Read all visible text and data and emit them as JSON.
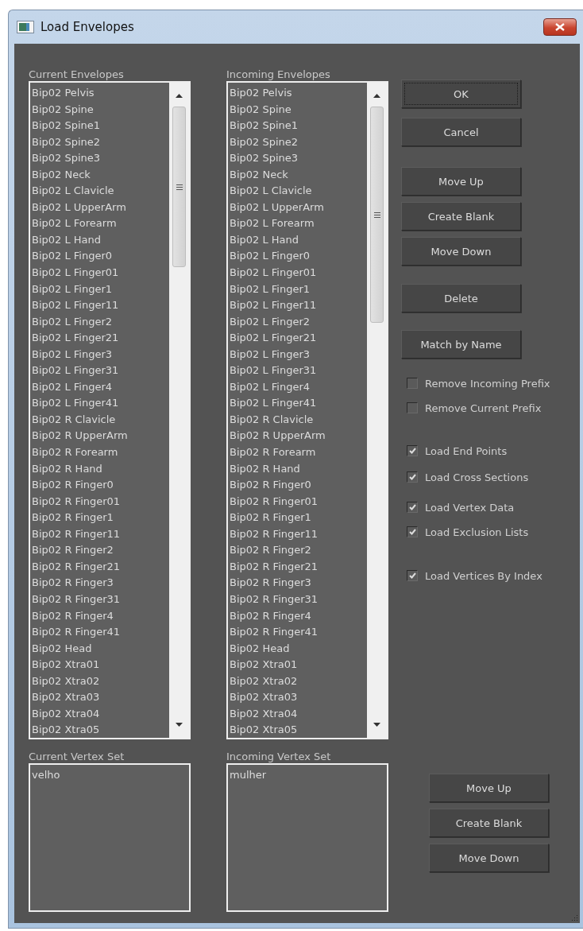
{
  "window": {
    "title": "Load Envelopes"
  },
  "current_envelopes": {
    "label": "Current Envelopes",
    "items": [
      "Bip02 Pelvis",
      "Bip02 Spine",
      "Bip02 Spine1",
      "Bip02 Spine2",
      "Bip02 Spine3",
      "Bip02 Neck",
      "Bip02 L Clavicle",
      "Bip02 L UpperArm",
      "Bip02 L Forearm",
      "Bip02 L Hand",
      "Bip02 L Finger0",
      "Bip02 L Finger01",
      "Bip02 L Finger1",
      "Bip02 L Finger11",
      "Bip02 L Finger2",
      "Bip02 L Finger21",
      "Bip02 L Finger3",
      "Bip02 L Finger31",
      "Bip02 L Finger4",
      "Bip02 L Finger41",
      "Bip02 R Clavicle",
      "Bip02 R UpperArm",
      "Bip02 R Forearm",
      "Bip02 R Hand",
      "Bip02 R Finger0",
      "Bip02 R Finger01",
      "Bip02 R Finger1",
      "Bip02 R Finger11",
      "Bip02 R Finger2",
      "Bip02 R Finger21",
      "Bip02 R Finger3",
      "Bip02 R Finger31",
      "Bip02 R Finger4",
      "Bip02 R Finger41",
      "Bip02 Head",
      "Bip02 Xtra01",
      "Bip02 Xtra02",
      "Bip02 Xtra03",
      "Bip02 Xtra04",
      "Bip02 Xtra05"
    ]
  },
  "incoming_envelopes": {
    "label": "Incoming Envelopes",
    "items": [
      "Bip02 Pelvis",
      "Bip02 Spine",
      "Bip02 Spine1",
      "Bip02 Spine2",
      "Bip02 Spine3",
      "Bip02 Neck",
      "Bip02 L Clavicle",
      "Bip02 L UpperArm",
      "Bip02 L Forearm",
      "Bip02 L Hand",
      "Bip02 L Finger0",
      "Bip02 L Finger01",
      "Bip02 L Finger1",
      "Bip02 L Finger11",
      "Bip02 L Finger2",
      "Bip02 L Finger21",
      "Bip02 L Finger3",
      "Bip02 L Finger31",
      "Bip02 L Finger4",
      "Bip02 L Finger41",
      "Bip02 R Clavicle",
      "Bip02 R UpperArm",
      "Bip02 R Forearm",
      "Bip02 R Hand",
      "Bip02 R Finger0",
      "Bip02 R Finger01",
      "Bip02 R Finger1",
      "Bip02 R Finger11",
      "Bip02 R Finger2",
      "Bip02 R Finger21",
      "Bip02 R Finger3",
      "Bip02 R Finger31",
      "Bip02 R Finger4",
      "Bip02 R Finger41",
      "Bip02 Head",
      "Bip02 Xtra01",
      "Bip02 Xtra02",
      "Bip02 Xtra03",
      "Bip02 Xtra04",
      "Bip02 Xtra05"
    ]
  },
  "button_groups": [
    [
      {
        "label": "OK",
        "focused": true
      },
      {
        "label": "Cancel",
        "focused": false
      }
    ],
    [
      {
        "label": "Move Up",
        "focused": false
      },
      {
        "label": "Create Blank",
        "focused": false
      },
      {
        "label": "Move Down",
        "focused": false
      }
    ],
    [
      {
        "label": "Delete",
        "focused": false
      }
    ],
    [
      {
        "label": "Match by Name",
        "focused": false
      }
    ]
  ],
  "option_groups": [
    [
      {
        "label": "Remove Incoming Prefix",
        "checked": false
      },
      {
        "label": "Remove Current Prefix",
        "checked": false
      }
    ],
    [
      {
        "label": "Load End Points",
        "checked": true
      },
      {
        "label": "Load Cross Sections",
        "checked": true
      }
    ],
    [
      {
        "label": "Load Vertex Data",
        "checked": true
      },
      {
        "label": "Load Exclusion Lists",
        "checked": true
      }
    ],
    [
      {
        "label": "Load Vertices By Index",
        "checked": true
      }
    ]
  ],
  "current_vertex_set": {
    "label": "Current Vertex Set",
    "items": [
      "velho"
    ]
  },
  "incoming_vertex_set": {
    "label": "Incoming Vertex Set",
    "items": [
      "mulher"
    ]
  },
  "vertex_set_buttons": [
    {
      "label": "Move Up",
      "focused": false
    },
    {
      "label": "Create Blank",
      "focused": false
    },
    {
      "label": "Move Down",
      "focused": false
    }
  ]
}
